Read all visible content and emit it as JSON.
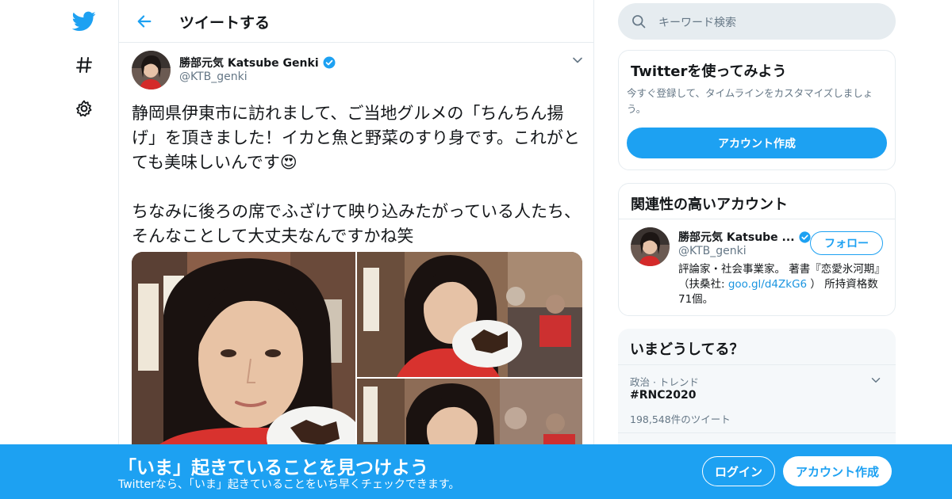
{
  "nav": {
    "icons": [
      "twitter-bird-icon",
      "hashtag-icon",
      "settings-gear-icon"
    ],
    "brand_color": "#1da1f2"
  },
  "header": {
    "title": "ツイートする"
  },
  "tweet": {
    "author_name": "勝部元気 Katsube Genki",
    "author_handle": "@KTB_genki",
    "verified": true,
    "text": "静岡県伊東市に訪れまして、ご当地グルメの「ちんちん揚げ」を頂きました！イカと魚と野菜のすり身です。これがとても美味しいんです😍\n\nちなみに後ろの席でふざけて映り込みたがっている人たち、そんなことして大丈夫なんですかね笑",
    "media_count": 3
  },
  "search": {
    "placeholder": "キーワード検索"
  },
  "signup_card": {
    "title": "Twitterを使ってみよう",
    "text": "今すぐ登録して、タイムラインをカスタマイズしましょう。",
    "button": "アカウント作成"
  },
  "related": {
    "title": "関連性の高いアカウント",
    "name": "勝部元気 Katsube ...",
    "handle": "@KTB_genki",
    "follow_button": "フォロー",
    "bio_prefix": "評論家・社会事業家。 著書『恋愛氷河期』（扶桑社: ",
    "bio_link": "goo.gl/d4ZkG6",
    "bio_suffix": " ） 所持資格数71個。"
  },
  "trends": {
    "title": "いまどうしてる？",
    "items": [
      {
        "category": "政治 · トレンド",
        "name": "#RNC2020",
        "count": "198,548件のツイート"
      }
    ]
  },
  "banner": {
    "title": "「いま」起きていることを見つけよう",
    "subtitle": "Twitterなら、「いま」起きていることをいち早くチェックできます。",
    "login": "ログイン",
    "signup": "アカウント作成"
  }
}
